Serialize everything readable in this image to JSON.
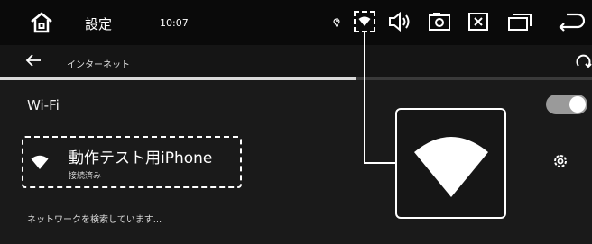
{
  "status_bar": {
    "title": "設定",
    "time": "10:07",
    "icons": [
      "home-icon",
      "location-icon",
      "wifi-signal-icon",
      "volume-icon",
      "screenshot-icon",
      "close-app-icon",
      "recent-apps-icon",
      "back-icon"
    ]
  },
  "nav_bar": {
    "back_icon": "arrow-left-icon",
    "title": "インターネット",
    "refresh_icon": "refresh-icon",
    "progress": 0.6
  },
  "wifi": {
    "label": "Wi-Fi",
    "enabled": true
  },
  "network": {
    "name": "動作テスト用iPhone",
    "status": "接続済み",
    "signal_icon": "wifi-signal-icon",
    "settings_icon": "gear-icon"
  },
  "scanning_text": "ネットワークを検索しています...",
  "colors": {
    "background": "#1a1a1a",
    "status_bar": "#0a0a0a",
    "accent": "#ffffff",
    "toggle_track": "#9a9a9a"
  }
}
